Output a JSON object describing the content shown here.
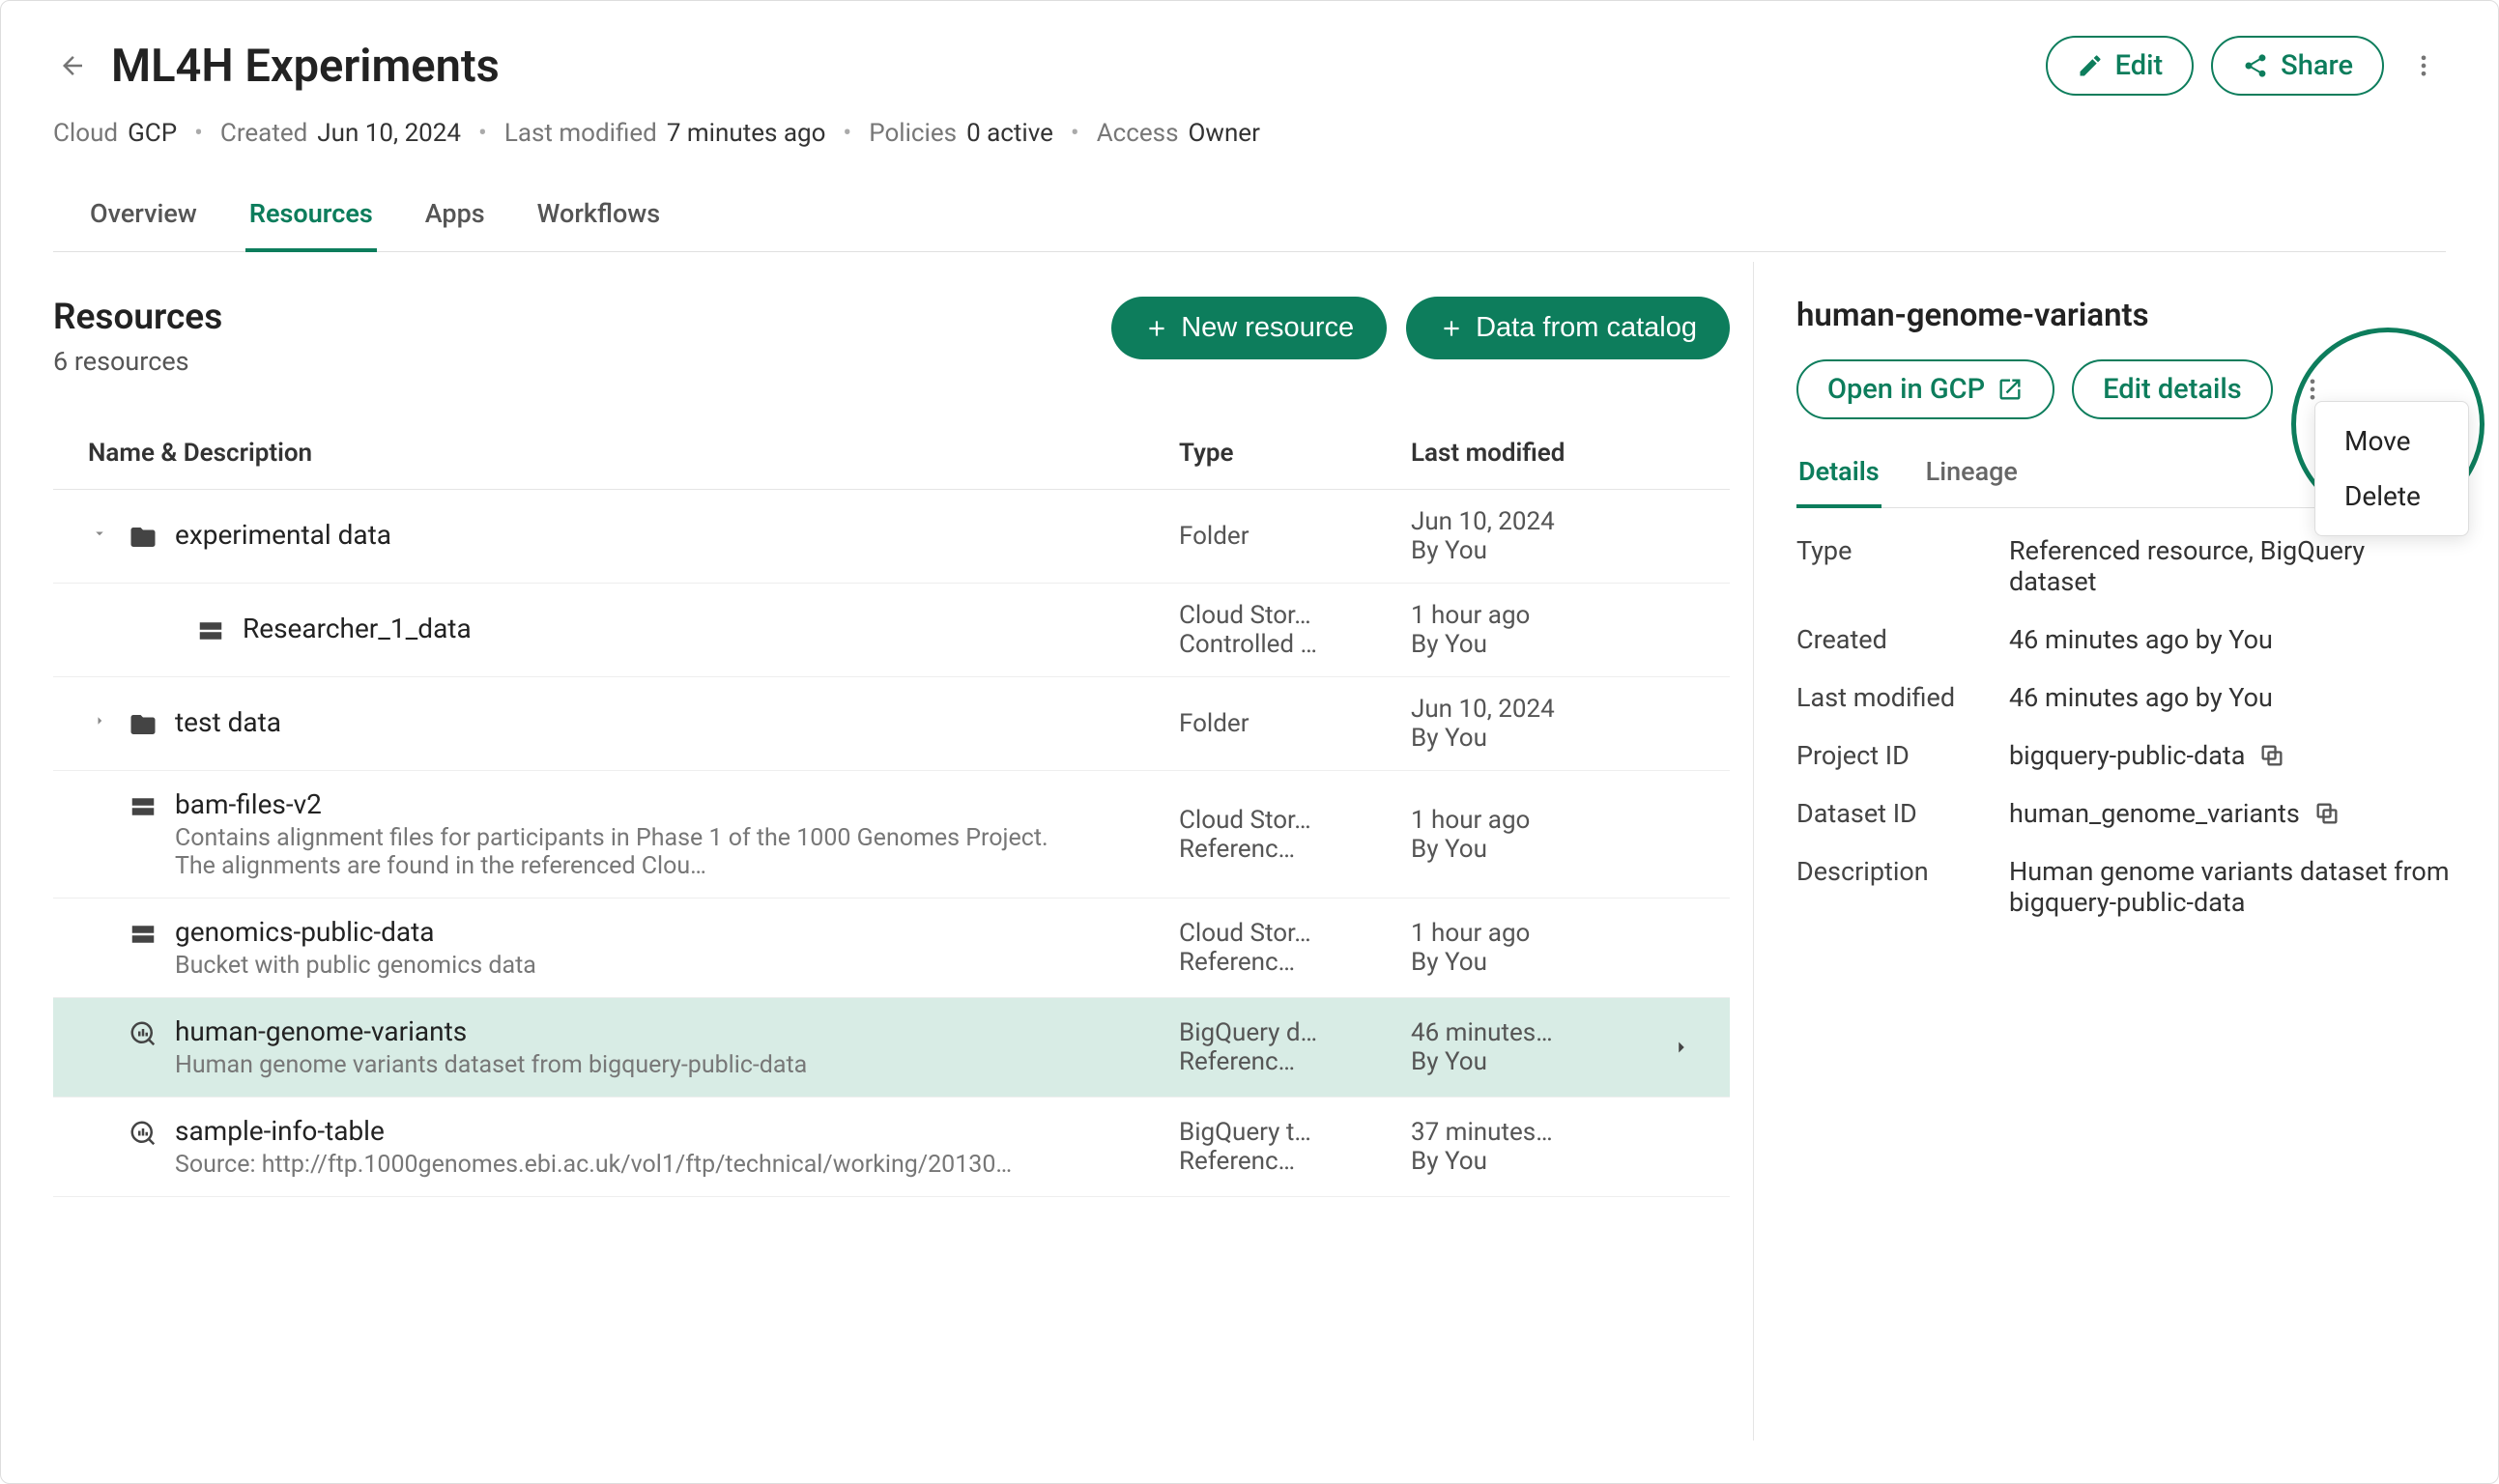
{
  "header": {
    "title": "ML4H Experiments",
    "edit_label": "Edit",
    "share_label": "Share",
    "meta": {
      "cloud_label": "Cloud",
      "cloud_value": "GCP",
      "created_label": "Created",
      "created_value": "Jun 10, 2024",
      "modified_label": "Last modified",
      "modified_value": "7 minutes ago",
      "policies_label": "Policies",
      "policies_value": "0 active",
      "access_label": "Access",
      "access_value": "Owner"
    },
    "tabs": [
      "Overview",
      "Resources",
      "Apps",
      "Workflows"
    ],
    "active_tab": 1
  },
  "main": {
    "title": "Resources",
    "subtitle": "6 resources",
    "buttons": {
      "new_resource": "New resource",
      "from_catalog": "Data from catalog"
    },
    "columns": {
      "name": "Name & Description",
      "type": "Type",
      "modified": "Last modified"
    },
    "rows": [
      {
        "kind": "folder",
        "expandable": true,
        "expanded": true,
        "name": "experimental data",
        "desc": "",
        "type1": "Folder",
        "type2": "",
        "mod1": "Jun 10, 2024",
        "mod2": "By You"
      },
      {
        "kind": "storage",
        "indent": true,
        "name": "Researcher_1_data",
        "desc": "",
        "type1": "Cloud Stor…",
        "type2": "Controlled …",
        "mod1": "1 hour ago",
        "mod2": "By You"
      },
      {
        "kind": "folder",
        "expandable": true,
        "expanded": false,
        "name": "test data",
        "desc": "",
        "type1": "Folder",
        "type2": "",
        "mod1": "Jun 10, 2024",
        "mod2": "By You"
      },
      {
        "kind": "storage",
        "name": "bam-files-v2",
        "desc": "Contains alignment files for participants in Phase 1 of the 1000 Genomes Project. The alignments are found in the referenced Clou…",
        "type1": "Cloud Stor…",
        "type2": "Referenc…",
        "mod1": "1 hour ago",
        "mod2": "By You"
      },
      {
        "kind": "storage",
        "name": "genomics-public-data",
        "desc": "Bucket with public genomics data",
        "type1": "Cloud Stor…",
        "type2": "Referenc…",
        "mod1": "1 hour ago",
        "mod2": "By You"
      },
      {
        "kind": "bigquery",
        "selected": true,
        "name": "human-genome-variants",
        "desc": "Human genome variants dataset from bigquery-public-data",
        "type1": "BigQuery d…",
        "type2": "Referenc…",
        "mod1": "46 minutes…",
        "mod2": "By You"
      },
      {
        "kind": "bigquery",
        "name": "sample-info-table",
        "desc": "Source: http://ftp.1000genomes.ebi.ac.uk/vol1/ftp/technical/working/20130…",
        "type1": "BigQuery t…",
        "type2": "Referenc…",
        "mod1": "37 minutes…",
        "mod2": "By You"
      }
    ]
  },
  "side": {
    "title": "human-genome-variants",
    "open_label": "Open in GCP",
    "edit_label": "Edit details",
    "tabs": [
      "Details",
      "Lineage"
    ],
    "active_tab": 0,
    "details": {
      "type_label": "Type",
      "type_value": "Referenced resource, BigQuery dataset",
      "created_label": "Created",
      "created_value": "46 minutes ago by You",
      "modified_label": "Last modified",
      "modified_value": "46 minutes ago by You",
      "project_label": "Project ID",
      "project_value": "bigquery-public-data",
      "dataset_label": "Dataset ID",
      "dataset_value": "human_genome_variants",
      "description_label": "Description",
      "description_value": "Human genome variants dataset from bigquery-public-data"
    },
    "menu": {
      "move": "Move",
      "delete": "Delete"
    }
  }
}
